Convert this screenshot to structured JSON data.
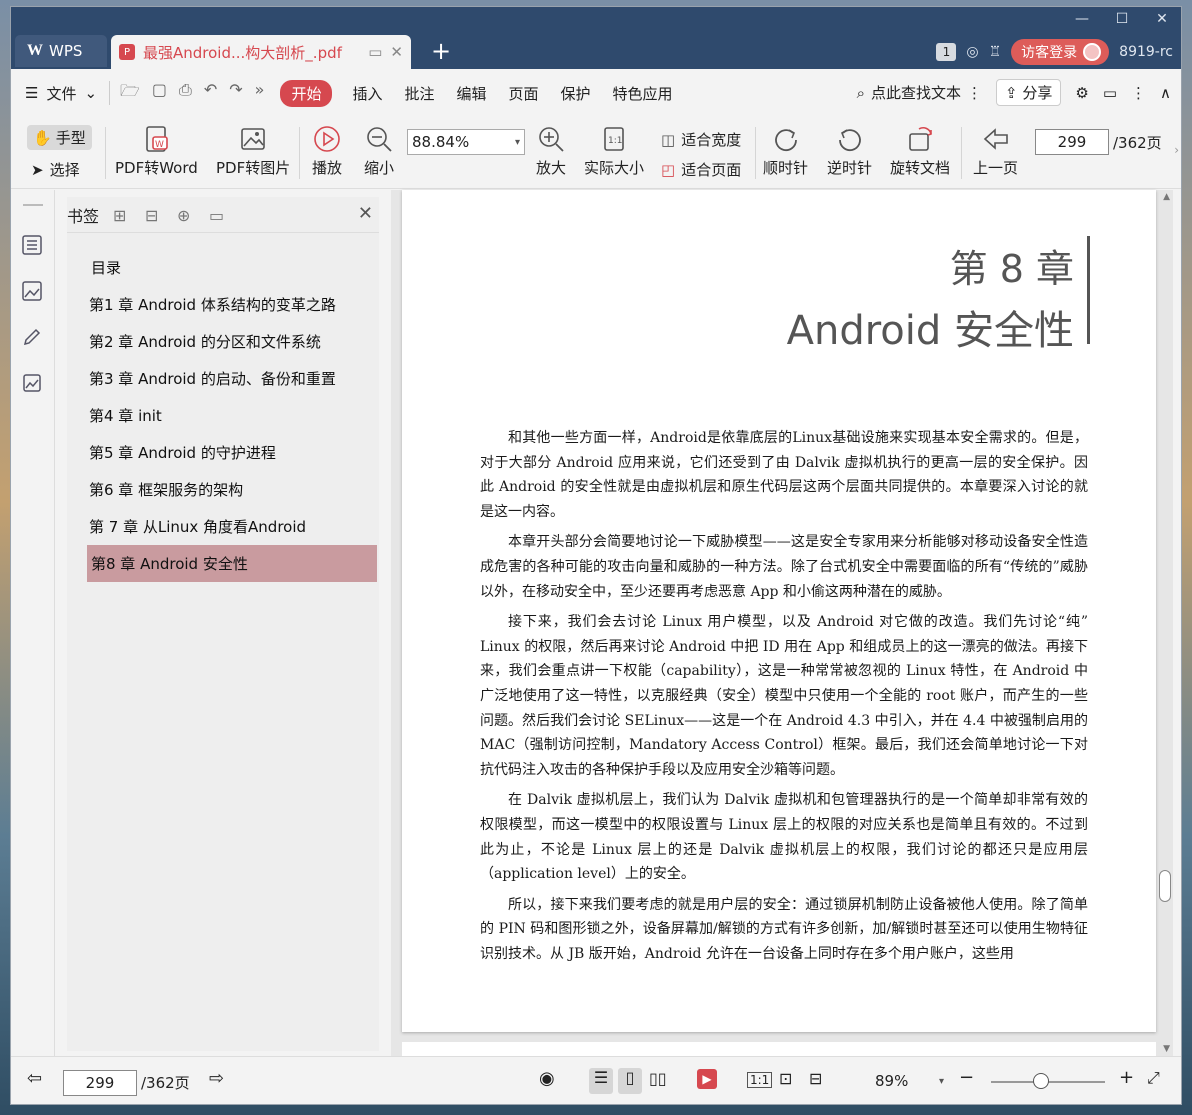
{
  "titlebar": {
    "app_tab": "WPS",
    "doc_tab": "最强Android...构大剖析_.pdf",
    "notif_count": "1",
    "login_label": "访客登录",
    "user_code": "8919-rc"
  },
  "menubar": {
    "file": "文件",
    "tabs": [
      "开始",
      "插入",
      "批注",
      "编辑",
      "页面",
      "保护",
      "特色应用"
    ],
    "search": "点此查找文本",
    "share": "分享"
  },
  "toolbar": {
    "hand": "手型",
    "select": "选择",
    "pdf_to_word": "PDF转Word",
    "pdf_to_image": "PDF转图片",
    "play": "播放",
    "zoom_out": "缩小",
    "zoom_value": "88.84%",
    "zoom_in": "放大",
    "actual_size": "实际大小",
    "fit_width": "适合宽度",
    "fit_page": "适合页面",
    "clockwise": "顺时针",
    "counterclockwise": "逆时针",
    "rotate_doc": "旋转文档",
    "prev_page": "上一页",
    "page_current": "299",
    "page_total": "/362页"
  },
  "bookmark": {
    "title": "书签",
    "items": [
      "目录",
      "第1 章 Android 体系结构的变革之路",
      "第2 章 Android 的分区和文件系统",
      "第3 章 Android 的启动、备份和重置",
      "第4 章 init",
      "第5 章 Android 的守护进程",
      "第6 章 框架服务的架构",
      "第 7 章 从Linux 角度看Android",
      "第8 章 Android 安全性"
    ]
  },
  "document": {
    "chapter_num": "第 8 章",
    "chapter_title": "Android 安全性",
    "paragraphs": [
      "和其他一些方面一样，Android是依靠底层的Linux基础设施来实现基本安全需求的。但是，对于大部分 Android 应用来说，它们还受到了由 Dalvik 虚拟机执行的更高一层的安全保护。因此 Android 的安全性就是由虚拟机层和原生代码层这两个层面共同提供的。本章要深入讨论的就是这一内容。",
      "本章开头部分会简要地讨论一下威胁模型——这是安全专家用来分析能够对移动设备安全性造成危害的各种可能的攻击向量和威胁的一种方法。除了台式机安全中需要面临的所有“传统的”威胁以外，在移动安全中，至少还要再考虑恶意 App 和小偷这两种潜在的威胁。",
      "接下来，我们会去讨论 Linux 用户模型，以及 Android 对它做的改造。我们先讨论“纯” Linux 的权限，然后再来讨论 Android 中把 ID 用在 App 和组成员上的这一漂亮的做法。再接下来，我们会重点讲一下权能（capability），这是一种常常被忽视的 Linux 特性，在 Android 中广泛地使用了这一特性，以克服经典（安全）模型中只使用一个全能的 root 账户，而产生的一些问题。然后我们会讨论 SELinux——这是一个在 Android 4.3 中引入，并在 4.4 中被强制启用的 MAC（强制访问控制，Mandatory Access Control）框架。最后，我们还会简单地讨论一下对抗代码注入攻击的各种保护手段以及应用安全沙箱等问题。",
      "在 Dalvik 虚拟机层上，我们认为 Dalvik 虚拟机和包管理器执行的是一个简单却非常有效的权限模型，而这一模型中的权限设置与 Linux 层上的权限的对应关系也是简单且有效的。不过到此为止，不论是 Linux 层上的还是 Dalvik 虚拟机层上的权限，我们讨论的都还只是应用层（application level）上的安全。",
      "所以，接下来我们要考虑的就是用户层的安全：通过锁屏机制防止设备被他人使用。除了简单的 PIN 码和图形锁之外，设备屏幕加/解锁的方式有许多创新，加/解锁时甚至还可以使用生物特征识别技术。从 JB 版开始，Android 允许在一台设备上同时存在多个用户账户，这些用"
    ]
  },
  "statusbar": {
    "page_current": "299",
    "page_total": "/362页",
    "zoom": "89%"
  }
}
